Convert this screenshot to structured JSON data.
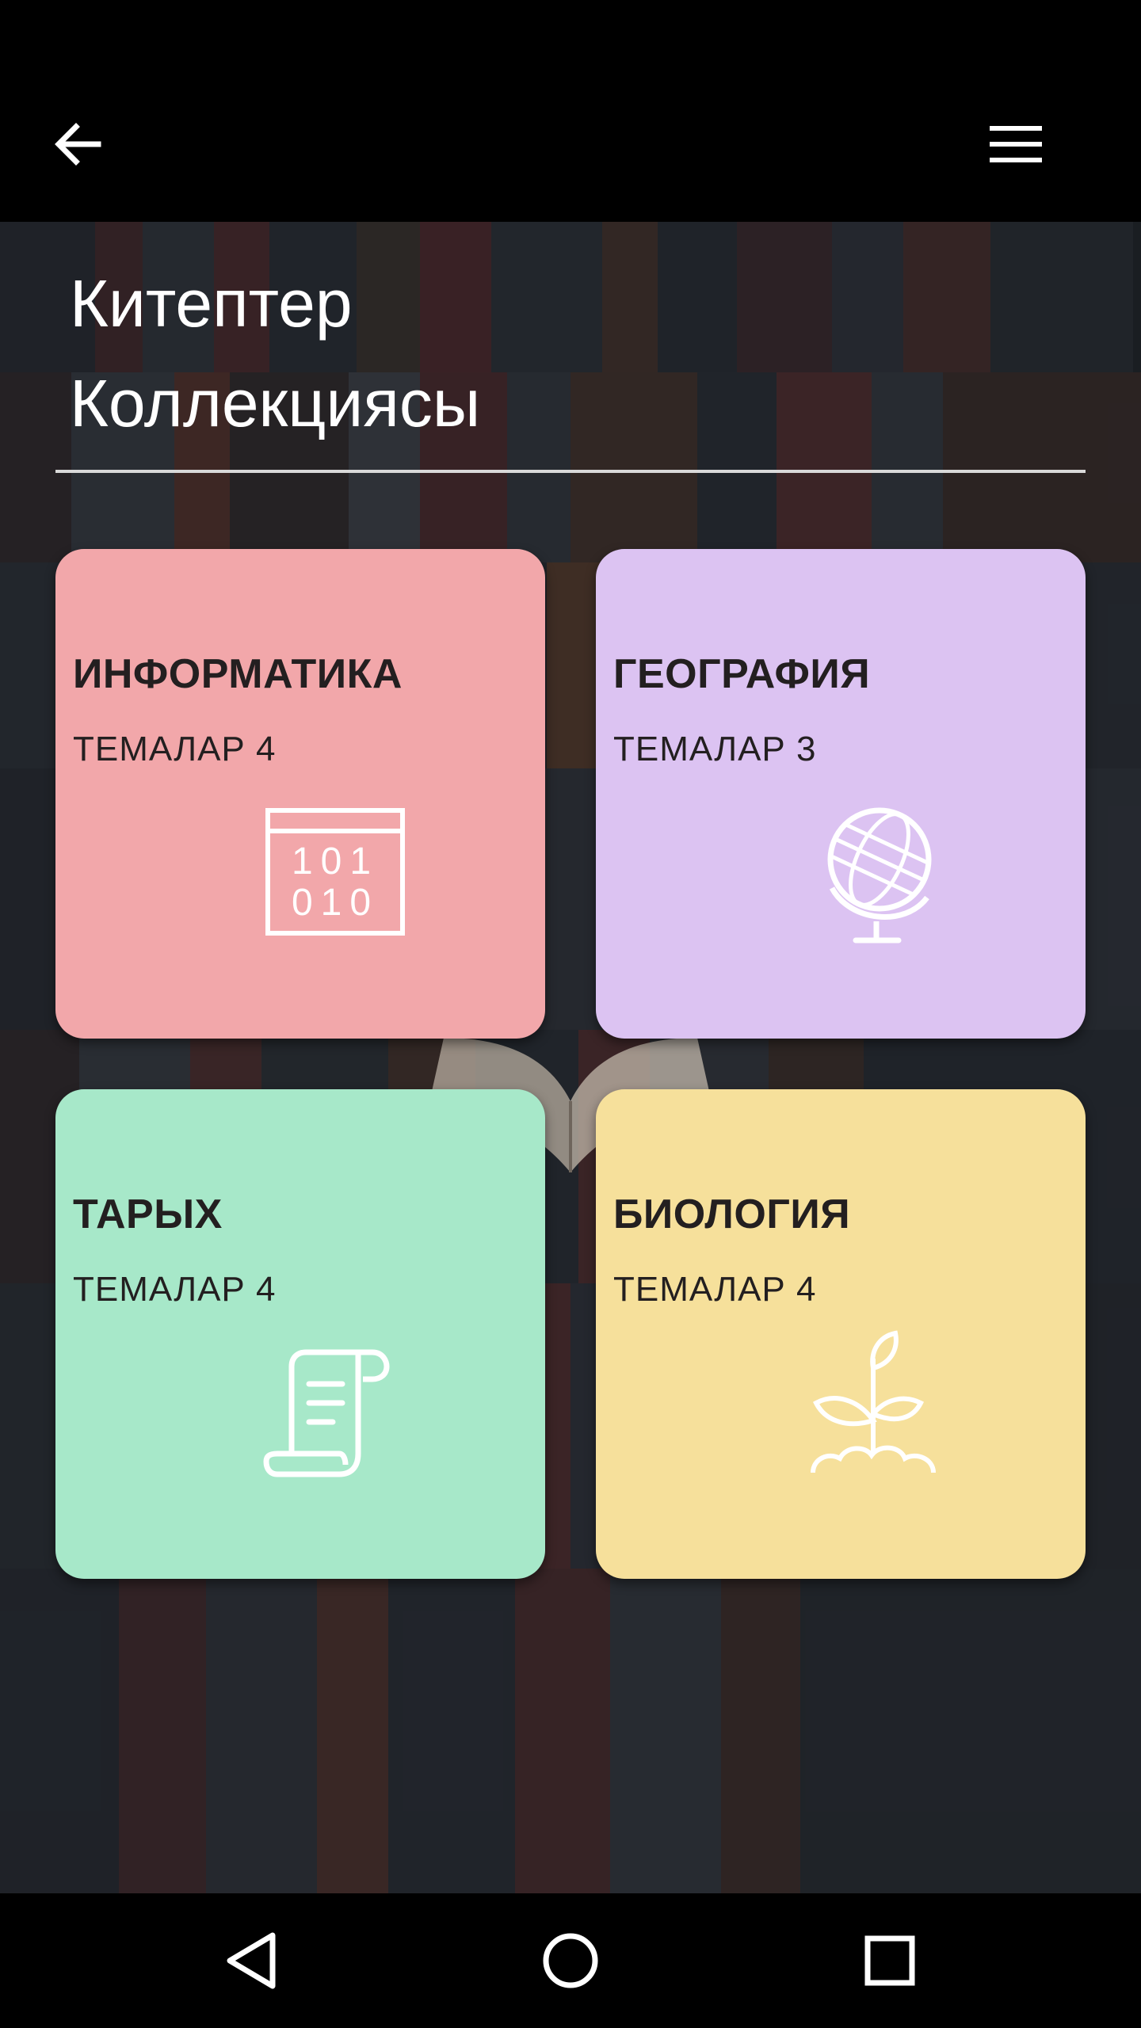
{
  "app_bar": {
    "back_icon": "arrow-left-icon",
    "menu_icon": "hamburger-menu-icon"
  },
  "page": {
    "title_line1": "Китептер",
    "title_line2": "Коллекциясы"
  },
  "cards": [
    {
      "title": "ИНФОРМАТИКА",
      "subtitle": "ТЕМАЛАР 4",
      "color": "#f2a7aa",
      "icon": "binary-code-icon"
    },
    {
      "title": "ГЕОГРАФИЯ",
      "subtitle": "ТЕМАЛАР 3",
      "color": "#dcc3f2",
      "icon": "globe-icon"
    },
    {
      "title": "ТАРЫХ",
      "subtitle": "ТЕМАЛАР 4",
      "color": "#a7e8c9",
      "icon": "scroll-icon"
    },
    {
      "title": "БИОЛОГИЯ",
      "subtitle": "ТЕМАЛАР 4",
      "color": "#f6e09b",
      "icon": "sprout-icon"
    }
  ],
  "nav_bar": {
    "back_icon": "nav-back-triangle-icon",
    "home_icon": "nav-home-circle-icon",
    "recents_icon": "nav-recents-square-icon"
  }
}
